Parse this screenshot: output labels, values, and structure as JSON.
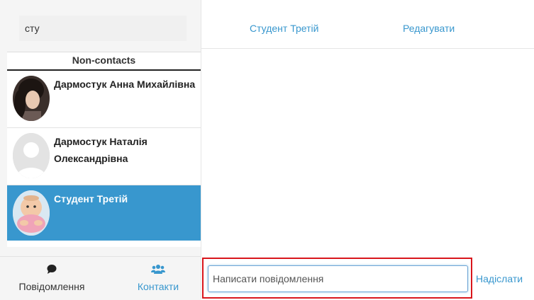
{
  "search": {
    "value": "сту"
  },
  "list": {
    "header": "Non-contacts",
    "contacts": [
      {
        "name": "Дармостук Анна Михайлівна",
        "avatar": "user-photo"
      },
      {
        "name": "Дармостук Наталія Олександрівна",
        "avatar": "default-user-silhouette"
      },
      {
        "name": "Студент Третій",
        "avatar": "user-photo",
        "active": true
      }
    ]
  },
  "nav": {
    "messages": {
      "label": "Повідомлення",
      "icon": "speech-bubble-icon"
    },
    "contacts": {
      "label": "Контакти",
      "icon": "users-icon"
    }
  },
  "chat": {
    "title": "Студент Третій",
    "edit_label": "Редагувати"
  },
  "compose": {
    "placeholder": "Написати повідомлення",
    "send_label": "Надіслати"
  },
  "colors": {
    "accent": "#3897ce",
    "highlight": "#d9161c"
  }
}
